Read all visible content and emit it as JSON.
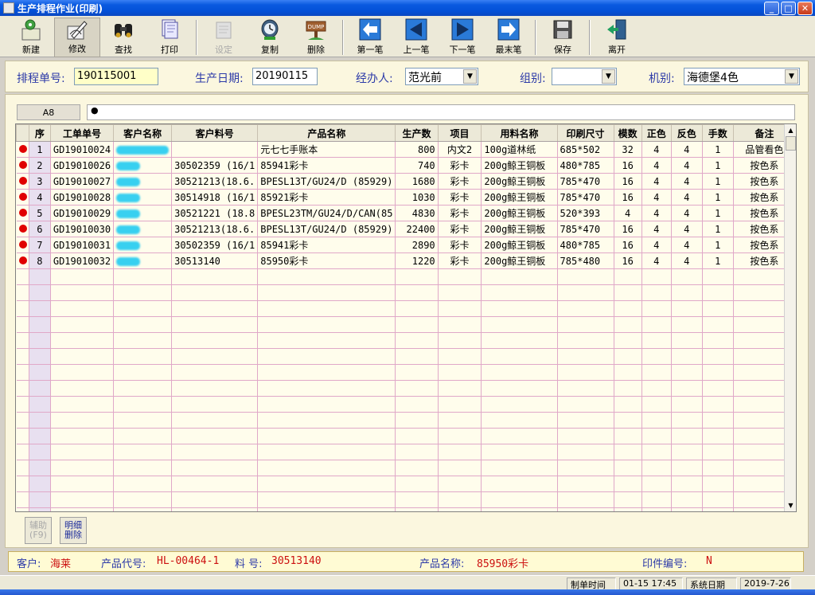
{
  "window": {
    "title": "生产排程作业(印刷)"
  },
  "toolbar": [
    {
      "key": "new",
      "label": "新建",
      "state": "normal"
    },
    {
      "key": "edit",
      "label": "修改",
      "state": "active"
    },
    {
      "key": "find",
      "label": "查找",
      "state": "normal"
    },
    {
      "key": "print",
      "label": "打印",
      "state": "normal"
    },
    {
      "key": "settings",
      "label": "设定",
      "state": "disabled"
    },
    {
      "key": "copy",
      "label": "复制",
      "state": "normal"
    },
    {
      "key": "delete",
      "label": "删除",
      "state": "normal"
    },
    {
      "key": "first",
      "label": "第一笔",
      "state": "normal"
    },
    {
      "key": "prev",
      "label": "上一笔",
      "state": "normal"
    },
    {
      "key": "next",
      "label": "下一笔",
      "state": "normal"
    },
    {
      "key": "last",
      "label": "最末笔",
      "state": "normal"
    },
    {
      "key": "save",
      "label": "保存",
      "state": "normal"
    },
    {
      "key": "exit",
      "label": "离开",
      "state": "normal"
    }
  ],
  "delete_icon_text": "DUMP",
  "form": {
    "schedule_no_label": "排程单号:",
    "schedule_no": "190115001",
    "prod_date_label": "生产日期:",
    "prod_date": "20190115",
    "handler_label": "经办人:",
    "handler": "范光前",
    "group_label": "组别:",
    "group": "",
    "machine_label": "机别:",
    "machine": "海德堡4色"
  },
  "cell_ref": "A8",
  "cell_content": "●",
  "grid": {
    "columns": [
      "",
      "序",
      "工单单号",
      "客户名称",
      "客户料号",
      "产品名称",
      "生产数",
      "项目",
      "用料名称",
      "印刷尺寸",
      "模数",
      "正色",
      "反色",
      "手数",
      "备注"
    ],
    "rows": [
      [
        "1",
        "GD19010024",
        "",
        "",
        "元七七手账本",
        "800",
        "内文2",
        "100g道林纸",
        "685*502",
        "32",
        "4",
        "4",
        "1",
        "品管看色"
      ],
      [
        "2",
        "GD19010026",
        "",
        "30502359 (16/1",
        "85941彩卡",
        "740",
        "彩卡",
        "200g鲸王铜板",
        "480*785",
        "16",
        "4",
        "4",
        "1",
        "按色系"
      ],
      [
        "3",
        "GD19010027",
        "",
        "30521213(18.6.",
        "BPESL13T/GU24/D (85929)",
        "1680",
        "彩卡",
        "200g鲸王铜板",
        "785*470",
        "16",
        "4",
        "4",
        "1",
        "按色系"
      ],
      [
        "4",
        "GD19010028",
        "",
        "30514918 (16/1",
        "85921彩卡",
        "1030",
        "彩卡",
        "200g鲸王铜板",
        "785*470",
        "16",
        "4",
        "4",
        "1",
        "按色系"
      ],
      [
        "5",
        "GD19010029",
        "",
        "30521221 (18.8",
        "BPESL23TM/GU24/D/CAN(85",
        "4830",
        "彩卡",
        "200g鲸王铜板",
        "520*393",
        "4",
        "4",
        "4",
        "1",
        "按色系"
      ],
      [
        "6",
        "GD19010030",
        "",
        "30521213(18.6.",
        "BPESL13T/GU24/D (85929)",
        "22400",
        "彩卡",
        "200g鲸王铜板",
        "785*470",
        "16",
        "4",
        "4",
        "1",
        "按色系"
      ],
      [
        "7",
        "GD19010031",
        "",
        "30502359 (16/1",
        "85941彩卡",
        "2890",
        "彩卡",
        "200g鲸王铜板",
        "480*785",
        "16",
        "4",
        "4",
        "1",
        "按色系"
      ],
      [
        "8",
        "GD19010032",
        "",
        "30513140",
        "85950彩卡",
        "1220",
        "彩卡",
        "200g鲸王铜板",
        "785*480",
        "16",
        "4",
        "4",
        "1",
        "按色系"
      ]
    ]
  },
  "buttons": {
    "assist": "辅助\n(F9)",
    "detail_delete": "明细\n删除"
  },
  "info": {
    "customer_label": "客户:",
    "customer": "海莱",
    "code_label": "产品代号:",
    "code": "HL-00464-1",
    "material_label": "料 号:",
    "material": "30513140",
    "name_label": "产品名称:",
    "name": "85950彩卡",
    "print_no_label": "印件编号:",
    "print_no": "N"
  },
  "status": {
    "made_time_label": "制单时间",
    "made_time": "01-15 17:45",
    "sys_date_label": "系统日期",
    "sys_date": "2019-7-26"
  },
  "colors": {
    "accent_red": "#cc1010",
    "label_blue": "#2c3aa8",
    "grid_line": "#e0a8c8"
  }
}
